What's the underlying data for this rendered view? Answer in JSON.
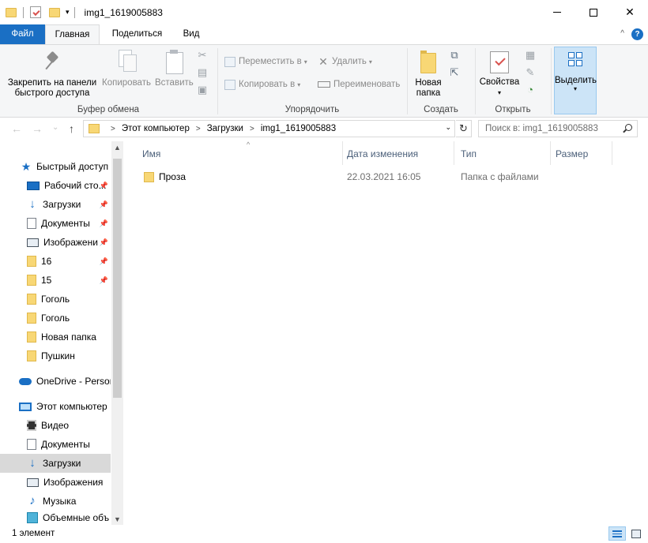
{
  "window": {
    "title": "img1_1619005883",
    "min_icon": "minimize-icon",
    "max_icon": "maximize-icon",
    "close_glyph": "✕"
  },
  "quick_access_toolbar": {
    "dropdown_glyph": "▾"
  },
  "tabs": {
    "file": "Файл",
    "home": "Главная",
    "share": "Поделиться",
    "view": "Вид",
    "collapse_glyph": "^",
    "help_glyph": "?"
  },
  "ribbon": {
    "clipboard": {
      "label": "Буфер обмена",
      "pin_line1": "Закрепить на панели",
      "pin_line2": "быстрого доступа",
      "copy": "Копировать",
      "paste": "Вставить"
    },
    "organize": {
      "label": "Упорядочить",
      "move_to": "Переместить в",
      "copy_to": "Копировать в",
      "delete": "Удалить",
      "rename": "Переименовать",
      "arrow": "▾"
    },
    "new": {
      "label": "Создать",
      "new_folder_line1": "Новая",
      "new_folder_line2": "папка"
    },
    "open": {
      "label": "Открыть",
      "properties": "Свойства",
      "arrow": "▾"
    },
    "select": {
      "label": "Выделить",
      "arrow": "▾"
    }
  },
  "address_bar": {
    "back_glyph": "←",
    "forward_glyph": "→",
    "recent_glyph": "⌄",
    "up_glyph": "↑",
    "crumb_sep": ">",
    "crumbs": [
      "Этот компьютер",
      "Загрузки",
      "img1_1619005883"
    ],
    "dropdown_glyph": "⌄",
    "refresh_glyph": "↻",
    "search_placeholder": "Поиск в: img1_1619005883"
  },
  "nav_pane": {
    "pin_glyph": "📌",
    "scroll_up": "▲",
    "scroll_down": "▼",
    "items": [
      {
        "label": "Быстрый доступ",
        "icon": "star-icon"
      },
      {
        "label": "Рабочий сто...",
        "icon": "desktop-icon",
        "pinned": true
      },
      {
        "label": "Загрузки",
        "icon": "download-icon",
        "pinned": true
      },
      {
        "label": "Документы",
        "icon": "document-icon",
        "pinned": true
      },
      {
        "label": "Изображени",
        "icon": "pictures-icon",
        "pinned": true
      },
      {
        "label": "16",
        "icon": "folder-icon",
        "pinned": true
      },
      {
        "label": "15",
        "icon": "folder-icon",
        "pinned": true
      },
      {
        "label": "Гоголь",
        "icon": "folder-icon"
      },
      {
        "label": "Гоголь",
        "icon": "folder-icon"
      },
      {
        "label": "Новая папка",
        "icon": "folder-icon"
      },
      {
        "label": "Пушкин",
        "icon": "folder-icon"
      },
      {
        "label": "OneDrive - Person",
        "icon": "onedrive-icon"
      },
      {
        "label": "Этот компьютер",
        "icon": "computer-icon"
      },
      {
        "label": "Видео",
        "icon": "video-icon"
      },
      {
        "label": "Документы",
        "icon": "document-icon"
      },
      {
        "label": "Загрузки",
        "icon": "download-icon",
        "selected": true
      },
      {
        "label": "Изображения",
        "icon": "pictures-icon"
      },
      {
        "label": "Музыка",
        "icon": "music-icon"
      },
      {
        "label": "Объемные объ",
        "icon": "3d-objects-icon"
      }
    ]
  },
  "file_list": {
    "sort_glyph": "^",
    "columns": [
      "Имя",
      "Дата изменения",
      "Тип",
      "Размер"
    ],
    "rows": [
      {
        "name": "Проза",
        "modified": "22.03.2021 16:05",
        "type": "Папка с файлами",
        "size": ""
      }
    ]
  },
  "status_bar": {
    "item_count": "1 элемент"
  }
}
